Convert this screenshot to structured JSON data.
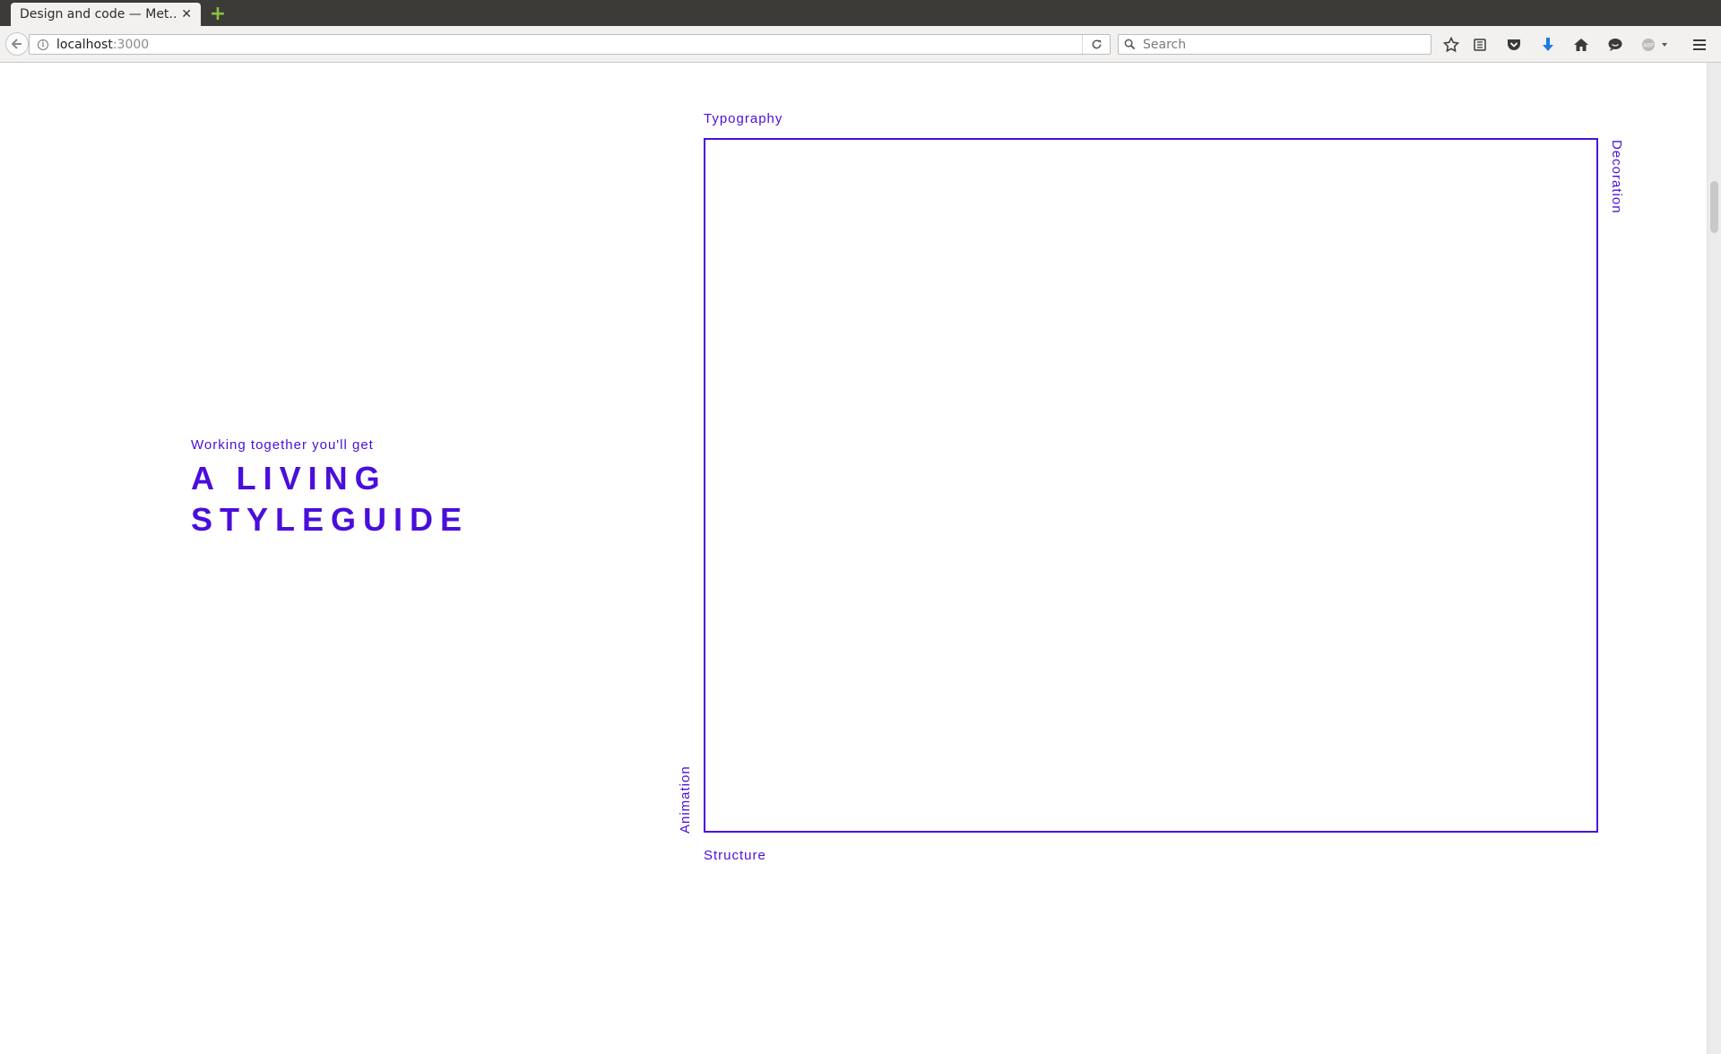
{
  "browser": {
    "tab": {
      "title": "Design and code — Met…"
    },
    "url": {
      "host": "localhost",
      "port": ":3000"
    },
    "search": {
      "placeholder": "Search"
    }
  },
  "hero": {
    "subtitle": "Working together you'll get",
    "title_line1": "A LIVING",
    "title_line2": "STYLEGUIDE"
  },
  "diagram": {
    "labels": {
      "top": "Typography",
      "right": "Decoration",
      "bottom": "Structure",
      "left": "Animation"
    }
  },
  "colors": {
    "accent": "#4a0edb",
    "chrome_dark": "#3c3b37",
    "chrome_light": "#f2f1f0"
  },
  "icons": [
    "back-arrow-icon",
    "info-icon",
    "reload-icon",
    "search-icon",
    "bookmark-star-icon",
    "reading-list-icon",
    "pocket-icon",
    "download-icon",
    "home-icon",
    "chat-icon",
    "adblock-icon",
    "menu-icon"
  ]
}
